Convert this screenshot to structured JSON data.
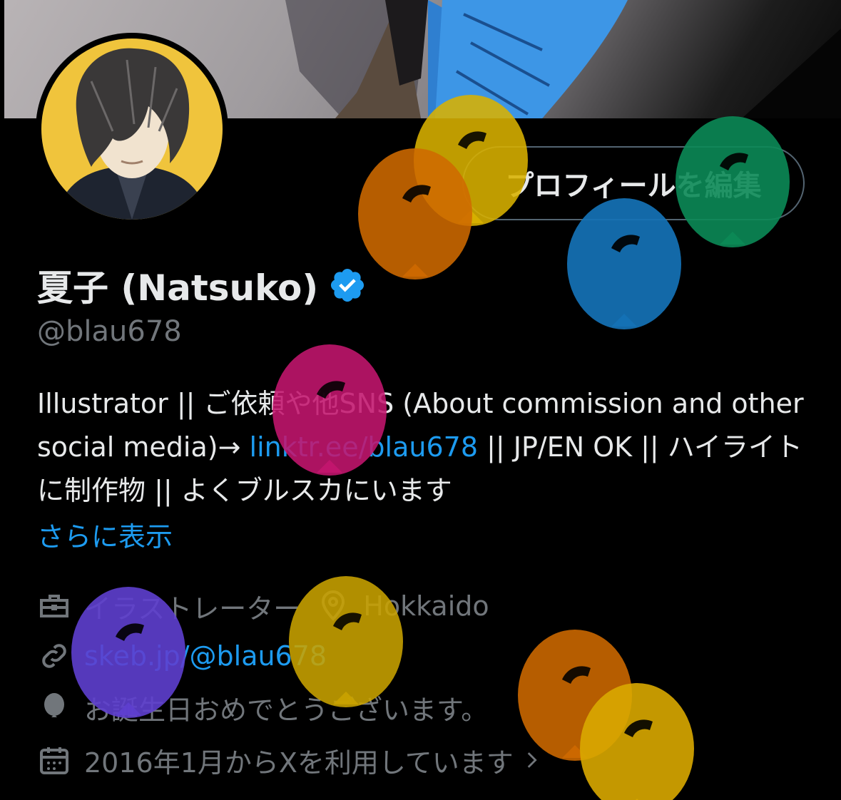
{
  "profile": {
    "edit_button": "プロフィールを編集",
    "name": "夏子 (Natsuko)",
    "handle": "@blau678",
    "bio": {
      "text1": "Illustrator || ご依頼や他SNS (About commission and other social media)→ ",
      "link": "linktr.ee/blau678",
      "text2": " || JP/EN OK || ハイライトに制作物 || よくブルスカにいます"
    },
    "show_more": "さらに表示",
    "occupation": "イラストレーター",
    "location": "Hokkaido",
    "website": "skeb.jp/@blau678",
    "birthday": "お誕生日おめでとうございます。",
    "joined": "2016年1月からXを利用しています"
  },
  "icons": {
    "verified": "verified-badge-icon",
    "occupation": "briefcase-icon",
    "location": "location-pin-icon",
    "website": "link-icon",
    "birthday": "balloon-icon",
    "joined": "calendar-icon"
  },
  "colors": {
    "background": "#000000",
    "text": "#e7e9ea",
    "muted": "#71767b",
    "link": "#1d9bf0",
    "verified": "#1d9bf0",
    "avatar_bg": "#f0c43c",
    "balloons": [
      "#d9b200",
      "#cf6a00",
      "#0b8a56",
      "#1572b6",
      "#c4166e",
      "#5e3fcf",
      "#c9a300",
      "#cf6a00",
      "#d9a800"
    ]
  }
}
